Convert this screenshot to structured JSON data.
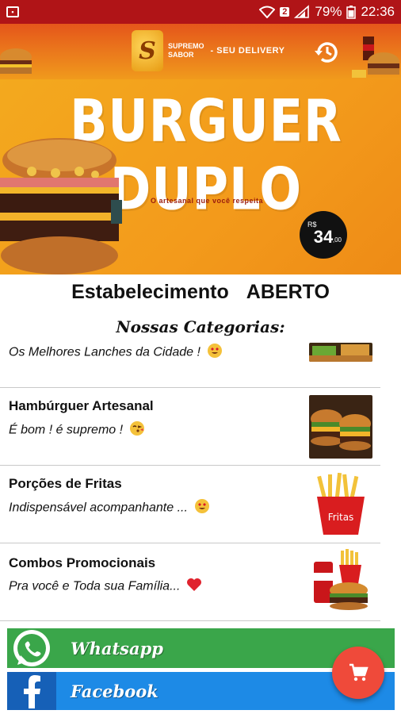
{
  "status_bar": {
    "battery": "79%",
    "time": "22:36",
    "notification_count": "2"
  },
  "header": {
    "brand_line1": "Supremo",
    "brand_line2": "Sabor",
    "tagline": "- Seu Delivery"
  },
  "banner": {
    "title": "BURGUER DUPLO",
    "subtitle": "O artesanal que você respeita",
    "price_currency": "R$",
    "price_value": "34",
    "price_cents": ",00"
  },
  "establishment": {
    "label": "Estabelecimento",
    "status": "ABERTO"
  },
  "categories": {
    "title": "Nossas Categorias:",
    "items": [
      {
        "name": "",
        "description": "Os Melhores Lanches da Cidade !",
        "emoji": "heart-eyes"
      },
      {
        "name": "Hambúrguer Artesanal",
        "description": "É bom !  é supremo !",
        "emoji": "kissing-face"
      },
      {
        "name": "Porções de Fritas",
        "description": "Indispensável acompanhante ...",
        "emoji": "heart-eyes"
      },
      {
        "name": "Combos Promocionais",
        "description": "Pra você e Toda sua Família...",
        "emoji": "red-heart"
      }
    ]
  },
  "social": {
    "whatsapp_label": "Whatsapp",
    "facebook_label": "Facebook"
  },
  "colors": {
    "status_bar": "#b01417",
    "header_top": "#e5561b",
    "header_bottom": "#f09a1c",
    "banner": "#f3a91e",
    "whatsapp": "#3aa64a",
    "facebook": "#1d8ae6",
    "fab": "#ef4a3a"
  },
  "icons": [
    "sim-icon",
    "wifi-icon",
    "signal-icon",
    "battery-icon",
    "history-icon",
    "whatsapp-icon",
    "facebook-icon",
    "cart-icon"
  ]
}
